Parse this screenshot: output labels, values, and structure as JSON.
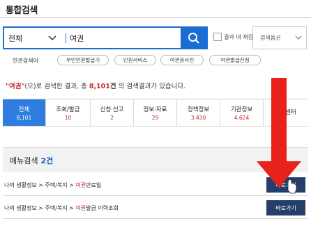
{
  "page_title": "통합검색",
  "search": {
    "scope": "전체",
    "query": "여권",
    "rescan_label": "결과 내 재검색",
    "options_label": "검색옵션"
  },
  "related": {
    "label": "연관검색어",
    "tags": [
      "무인민원발급기",
      "민원서비스",
      "여권용사진",
      "여권발급신청"
    ]
  },
  "result_summary": {
    "open_quote": "\"",
    "keyword": "여권",
    "close_quote": "\"",
    "mid": "(으)로 검색한 결과, 총 ",
    "total": "8,101",
    "unit": "건",
    "tail": " 의 검색결과가 있습니다."
  },
  "tabs": [
    {
      "label": "전체",
      "count": "8,101",
      "active": true
    },
    {
      "label": "조회/발급",
      "count": "10"
    },
    {
      "label": "신청·신고",
      "count": "2"
    },
    {
      "label": "정보·자료",
      "count": "29"
    },
    {
      "label": "정책정보",
      "count": "3,430"
    },
    {
      "label": "기관정보",
      "count": "4,624"
    },
    {
      "label": "고객센터",
      "count": ""
    }
  ],
  "menu_search": {
    "title": "메뉴검색",
    "count": "2건"
  },
  "menu_results": [
    {
      "prefix": "나의 생활정보 > 주택/복지 > ",
      "highlight": "여권",
      "suffix": "만료일",
      "button": "바로가기"
    },
    {
      "prefix": "나의 생활정보 > 주택/복지 > ",
      "highlight": "여권",
      "suffix": "발급 이력조회",
      "button": "바로가기"
    }
  ],
  "colors": {
    "primary": "#1a6ed3",
    "active_tab": "#2f7de1",
    "accent_red": "#c0272d",
    "button_navy": "#253f6a",
    "annotation_arrow": "#e8211b"
  }
}
